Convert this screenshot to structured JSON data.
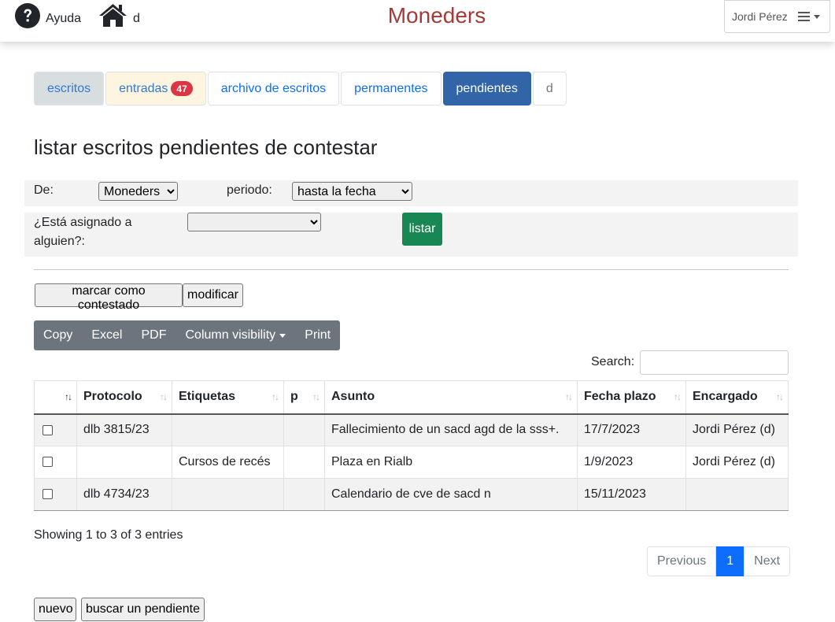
{
  "nav": {
    "help_label": "Ayuda",
    "home_label": "d",
    "brand": "Moneders",
    "user_name": "Jordi Pérez"
  },
  "tabs": [
    {
      "label": "escritos"
    },
    {
      "label": "entradas",
      "badge": "47"
    },
    {
      "label": "archivo de escritos"
    },
    {
      "label": "permanentes"
    },
    {
      "label": "pendientes",
      "active": true
    },
    {
      "label": "d"
    }
  ],
  "page_title": "listar escritos pendientes de contestar",
  "filters": {
    "de_label": "De:",
    "de_value": "Moneders",
    "periodo_label": "periodo:",
    "periodo_value": "hasta la fecha",
    "asignado_label": "¿Está asignado a alguien?:",
    "asignado_value": "",
    "listar_label": "listar"
  },
  "actions": {
    "marcar_label": "marcar como contestado",
    "modificar_label": "modificar"
  },
  "dt_buttons": [
    "Copy",
    "Excel",
    "PDF",
    "Column visibility",
    "Print"
  ],
  "search": {
    "label": "Search:",
    "value": ""
  },
  "table": {
    "columns": [
      "",
      "Protocolo",
      "Etiquetas",
      "p",
      "Asunto",
      "Fecha plazo",
      "Encargado"
    ],
    "rows": [
      {
        "protocolo": "dlb 3815/23",
        "etiquetas": "",
        "p": "",
        "asunto": "Fallecimiento de un sacd agd de la sss+.",
        "fecha": "17/7/2023",
        "encargado": "Jordi Pérez (d)"
      },
      {
        "protocolo": "",
        "etiquetas": "Cursos de recés",
        "p": "",
        "asunto": "Plaza en Rialb",
        "fecha": "1/9/2023",
        "encargado": "Jordi Pérez (d)"
      },
      {
        "protocolo": "dlb 4734/23",
        "etiquetas": "",
        "p": "",
        "asunto": "Calendario de cve de sacd n",
        "fecha": "15/11/2023",
        "encargado": ""
      }
    ]
  },
  "info_text": "Showing 1 to 3 of 3 entries",
  "pagination": {
    "previous": "Previous",
    "current": "1",
    "next": "Next"
  },
  "bottom": {
    "nuevo_label": "nuevo",
    "buscar_label": "buscar un pendiente"
  },
  "colors": {
    "brand": "#a33a3a",
    "active_tab": "#3264a8",
    "listar": "#198754",
    "badge": "#dc3545",
    "page_active": "#0d6efd"
  }
}
